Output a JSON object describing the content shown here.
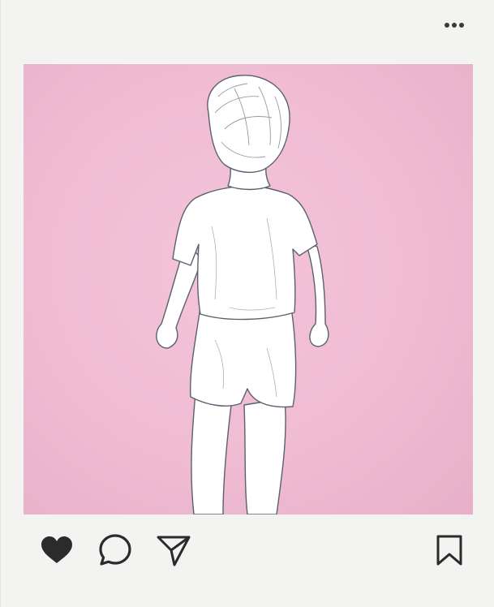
{
  "post": {
    "menu_icon": "more-horizontal-icon",
    "image_subject": "pencil-sketch-child-walking-away",
    "background_color": "#f3c0d6",
    "liked": true
  },
  "actions": {
    "like_icon": "heart-filled-icon",
    "comment_icon": "comment-bubble-icon",
    "share_icon": "paper-plane-icon",
    "save_icon": "bookmark-icon",
    "icon_color": "#2b2b2b"
  }
}
